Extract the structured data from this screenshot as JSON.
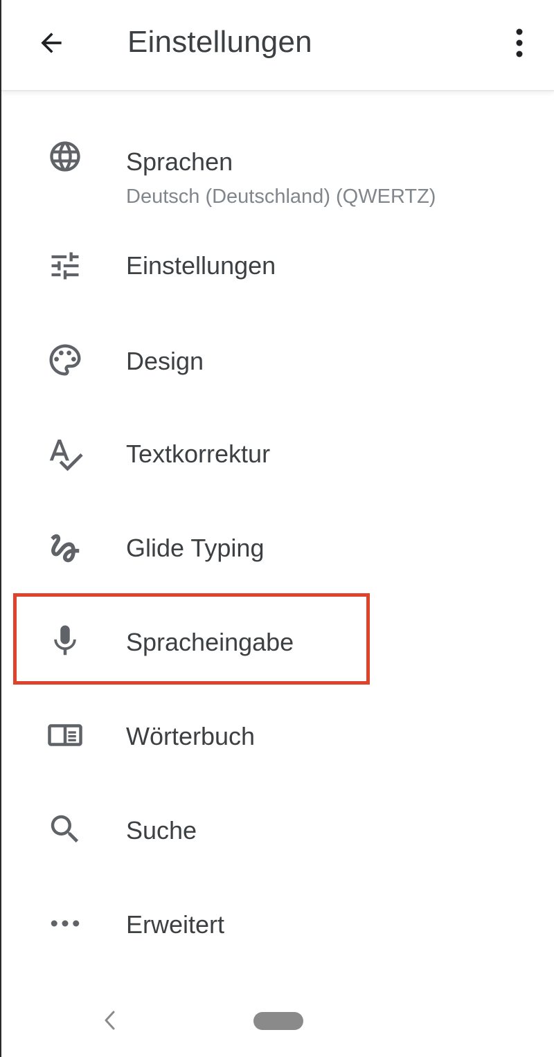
{
  "app_bar": {
    "title": "Einstellungen",
    "back_icon": "arrow-back-icon",
    "overflow_icon": "more-vert-icon"
  },
  "menu": {
    "items": [
      {
        "label": "Sprachen",
        "subtitle": "Deutsch (Deutschland) (QWERTZ)",
        "icon": "globe-icon"
      },
      {
        "label": "Einstellungen",
        "icon": "tune-icon"
      },
      {
        "label": "Design",
        "icon": "palette-icon"
      },
      {
        "label": "Textkorrektur",
        "icon": "spellcheck-icon"
      },
      {
        "label": "Glide Typing",
        "icon": "gesture-icon"
      },
      {
        "label": "Spracheingabe",
        "icon": "microphone-icon"
      },
      {
        "label": "Wörterbuch",
        "icon": "dictionary-icon"
      },
      {
        "label": "Suche",
        "icon": "search-icon"
      },
      {
        "label": "Erweitert",
        "icon": "more-horiz-icon"
      }
    ]
  },
  "annotation": {
    "highlighted_item": "Spracheingabe",
    "color": "#e0432c"
  },
  "colors": {
    "icon": "#5f6368",
    "text": "#3c4043",
    "subtitle": "#80868b"
  },
  "nav_bar": {
    "back_icon": "nav-back-icon",
    "home_icon": "home-pill-icon"
  }
}
